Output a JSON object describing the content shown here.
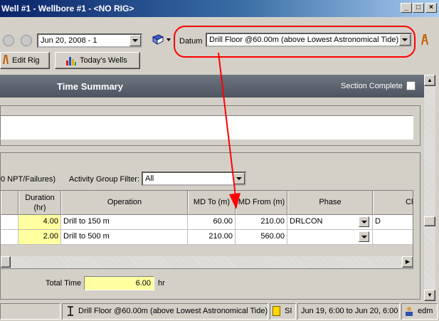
{
  "window": {
    "title": "Well #1 - Wellbore #1 - <NO RIG>"
  },
  "toolbar": {
    "date_value": "Jun 20, 2008 -   1",
    "datum_label": "Datum",
    "datum_value": "Drill Floor @60.00m (above Lowest Astronomical Tide)",
    "edit_rig_label": "Edit Rig",
    "todays_wells_label": "Today's Wells"
  },
  "panel": {
    "title": "Time Summary",
    "section_complete_label": "Section Complete"
  },
  "filter": {
    "npt_label": "0 NPT/Failures)",
    "activity_group_label": "Activity Group Filter:",
    "activity_group_value": "All"
  },
  "table": {
    "headers": {
      "duration": "Duration (hr)",
      "operation": "Operation",
      "md_to": "MD To (m)",
      "md_from": "MD From (m)",
      "phase": "Phase",
      "cl": "Cl"
    },
    "rows": [
      {
        "duration": "4.00",
        "operation": "Drill to 150 m",
        "md_to": "60.00",
        "md_from": "210.00",
        "phase": "DRLCON",
        "cl": "D"
      },
      {
        "duration": "2.00",
        "operation": "Drill to 500 m",
        "md_to": "210.00",
        "md_from": "560.00",
        "phase": "",
        "cl": ""
      }
    ]
  },
  "totals": {
    "label": "Total Time",
    "value": "6.00",
    "unit": "hr"
  },
  "statusbar": {
    "datum": "Drill Floor @60.00m (above Lowest Astronomical Tide)",
    "units": "SI",
    "range": "Jun 19, 6:00 to Jun 20, 6:00",
    "user": "edm"
  },
  "colors": {
    "annotation_red": "#ff0000",
    "highlight_yellow": "#ffffa0",
    "panel_header": "#5a6270"
  }
}
